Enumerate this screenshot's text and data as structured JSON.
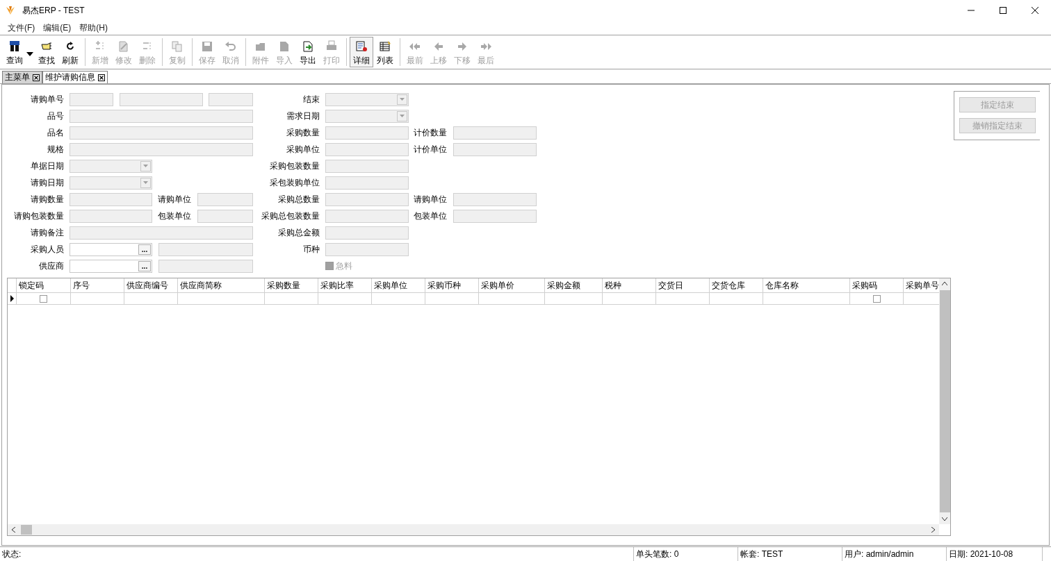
{
  "window": {
    "title": "易杰ERP - TEST"
  },
  "menu": [
    "文件(F)",
    "编辑(E)",
    "帮助(H)"
  ],
  "toolbar": [
    [
      {
        "label": "查询",
        "disabled": false,
        "dropdown": true
      },
      {
        "label": "查找",
        "disabled": false
      },
      {
        "label": "刷新",
        "disabled": false
      }
    ],
    [
      {
        "label": "新增",
        "disabled": true
      },
      {
        "label": "修改",
        "disabled": true
      },
      {
        "label": "删除",
        "disabled": true
      }
    ],
    [
      {
        "label": "复制",
        "disabled": true
      }
    ],
    [
      {
        "label": "保存",
        "disabled": true
      },
      {
        "label": "取消",
        "disabled": true
      }
    ],
    [
      {
        "label": "附件",
        "disabled": true
      },
      {
        "label": "导入",
        "disabled": true
      },
      {
        "label": "导出",
        "disabled": false
      },
      {
        "label": "打印",
        "disabled": true
      }
    ],
    [
      {
        "label": "详细",
        "disabled": false,
        "selected": true
      },
      {
        "label": "列表",
        "disabled": false,
        "selected": false
      }
    ],
    [
      {
        "label": "最前",
        "disabled": true
      },
      {
        "label": "上移",
        "disabled": true
      },
      {
        "label": "下移",
        "disabled": true
      },
      {
        "label": "最后",
        "disabled": true
      }
    ]
  ],
  "tabs": [
    {
      "label": "主菜单",
      "selected": false
    },
    {
      "label": "维护请购信息",
      "selected": true
    }
  ],
  "form": {
    "rows": [
      {
        "left": {
          "label": "请购单号",
          "kind": "triple"
        },
        "middle": {
          "label": "结束",
          "kind": "combo"
        }
      },
      {
        "left": {
          "label": "品号",
          "kind": "wide"
        },
        "middle": {
          "label": "需求日期",
          "kind": "combo"
        }
      },
      {
        "left": {
          "label": "品名",
          "kind": "wide"
        },
        "middle": {
          "label": "采购数量",
          "kind": "text"
        },
        "right": {
          "label": "计价数量"
        }
      },
      {
        "left": {
          "label": "规格",
          "kind": "wide"
        },
        "middle": {
          "label": "采购单位",
          "kind": "text"
        },
        "right": {
          "label": "计价单位"
        }
      },
      {
        "left": {
          "label": "单据日期",
          "kind": "date"
        },
        "middle": {
          "label": "采购包装数量",
          "kind": "text"
        }
      },
      {
        "left": {
          "label": "请购日期",
          "kind": "date"
        },
        "middle": {
          "label": "采包装购单位",
          "kind": "text"
        }
      },
      {
        "left": {
          "label": "请购数量",
          "kind": "pair",
          "sublabel": "请购单位"
        },
        "middle": {
          "label": "采购总数量",
          "kind": "text"
        },
        "right": {
          "label": "请购单位"
        }
      },
      {
        "left": {
          "label": "请购包装数量",
          "kind": "pair",
          "sublabel": "包装单位"
        },
        "middle": {
          "label": "采购总包装数量",
          "kind": "text"
        },
        "right": {
          "label": "包装单位"
        }
      },
      {
        "left": {
          "label": "请购备注",
          "kind": "wide"
        },
        "middle": {
          "label": "采购总金额",
          "kind": "text"
        }
      },
      {
        "left": {
          "label": "采购人员",
          "kind": "lookup",
          "button": "..."
        },
        "middle": {
          "label": "币种",
          "kind": "text"
        }
      },
      {
        "left": {
          "label": "供应商",
          "kind": "lookup",
          "button": "..."
        },
        "middle": {
          "label": "急料",
          "kind": "check",
          "disabled": true
        }
      }
    ]
  },
  "side_buttons": [
    {
      "label": "指定结束",
      "disabled": true
    },
    {
      "label": "撤销指定结束",
      "disabled": true
    }
  ],
  "table": {
    "columns": [
      {
        "label": "锁定码",
        "kind": "check"
      },
      {
        "label": "序号",
        "kind": "text"
      },
      {
        "label": "供应商编号",
        "kind": "text"
      },
      {
        "label": "供应商简称",
        "kind": "text"
      },
      {
        "label": "采购数量",
        "kind": "text"
      },
      {
        "label": "采购比率",
        "kind": "text"
      },
      {
        "label": "采购单位",
        "kind": "text"
      },
      {
        "label": "采购币种",
        "kind": "text"
      },
      {
        "label": "采购单价",
        "kind": "text"
      },
      {
        "label": "采购金额",
        "kind": "text"
      },
      {
        "label": "税种",
        "kind": "text"
      },
      {
        "label": "交货日",
        "kind": "text"
      },
      {
        "label": "交货仓库",
        "kind": "text"
      },
      {
        "label": "仓库名称",
        "kind": "text"
      },
      {
        "label": "采购码",
        "kind": "check"
      },
      {
        "label": "采购单号",
        "kind": "text"
      }
    ],
    "rows": [
      {
        "current": true,
        "checks": [
          false,
          false
        ]
      }
    ]
  },
  "status_bar": [
    "状态:",
    "单头笔数: 0",
    "帐套: TEST",
    "用户: admin/admin",
    "日期: 2021-10-08"
  ]
}
